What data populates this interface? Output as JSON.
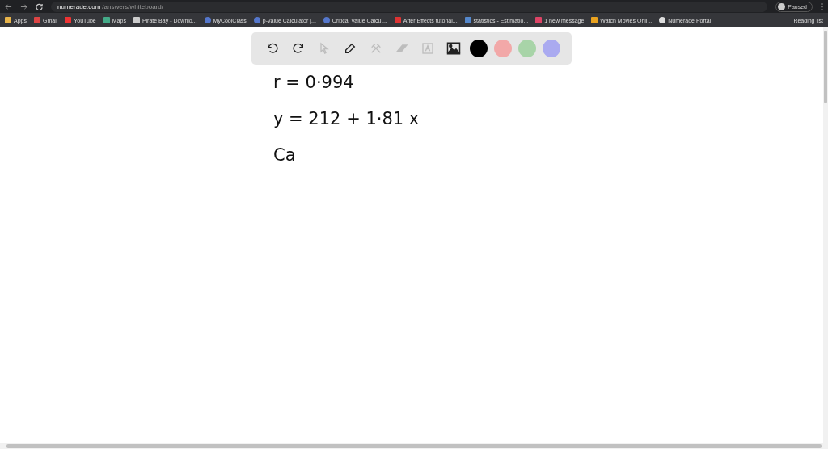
{
  "browser": {
    "url_host": "numerade.com",
    "url_path": "/answers/whiteboard/",
    "profile": "Paused",
    "reading_list": "Reading list"
  },
  "bookmarks": [
    {
      "label": "Apps",
      "kind": "apps"
    },
    {
      "label": "Gmail",
      "kind": "mail"
    },
    {
      "label": "YouTube",
      "kind": "play"
    },
    {
      "label": "Maps",
      "kind": "map"
    },
    {
      "label": "Pirate Bay - Downlo...",
      "kind": "page"
    },
    {
      "label": "MyCoolClass",
      "kind": "dot"
    },
    {
      "label": "p-value Calculator |...",
      "kind": "dot"
    },
    {
      "label": "Critical Value Calcul...",
      "kind": "dot"
    },
    {
      "label": "After Effects tutorial...",
      "kind": "triangle"
    },
    {
      "label": "statistics - Estimatio...",
      "kind": "trophy"
    },
    {
      "label": "1 new message",
      "kind": "feather"
    },
    {
      "label": "Watch Movies Onli...",
      "kind": "square"
    },
    {
      "label": "Numerade Portal",
      "kind": "globe"
    }
  ],
  "toolbar": {
    "tools": [
      {
        "kind": "undo",
        "disabled": false
      },
      {
        "kind": "redo",
        "disabled": false
      },
      {
        "kind": "select",
        "disabled": true
      },
      {
        "kind": "pen",
        "disabled": false
      },
      {
        "kind": "tools",
        "disabled": true
      },
      {
        "kind": "eraser",
        "disabled": true
      },
      {
        "kind": "text",
        "disabled": true
      },
      {
        "kind": "image",
        "disabled": false
      }
    ],
    "colors": [
      {
        "color": "#000000"
      },
      {
        "color": "#f2a8a8"
      },
      {
        "color": "#a8d4a8"
      },
      {
        "color": "#aaaaf0"
      }
    ]
  },
  "handwriting": [
    "r = 0·994",
    "y = 212 + 1·81 x",
    "Ca"
  ]
}
